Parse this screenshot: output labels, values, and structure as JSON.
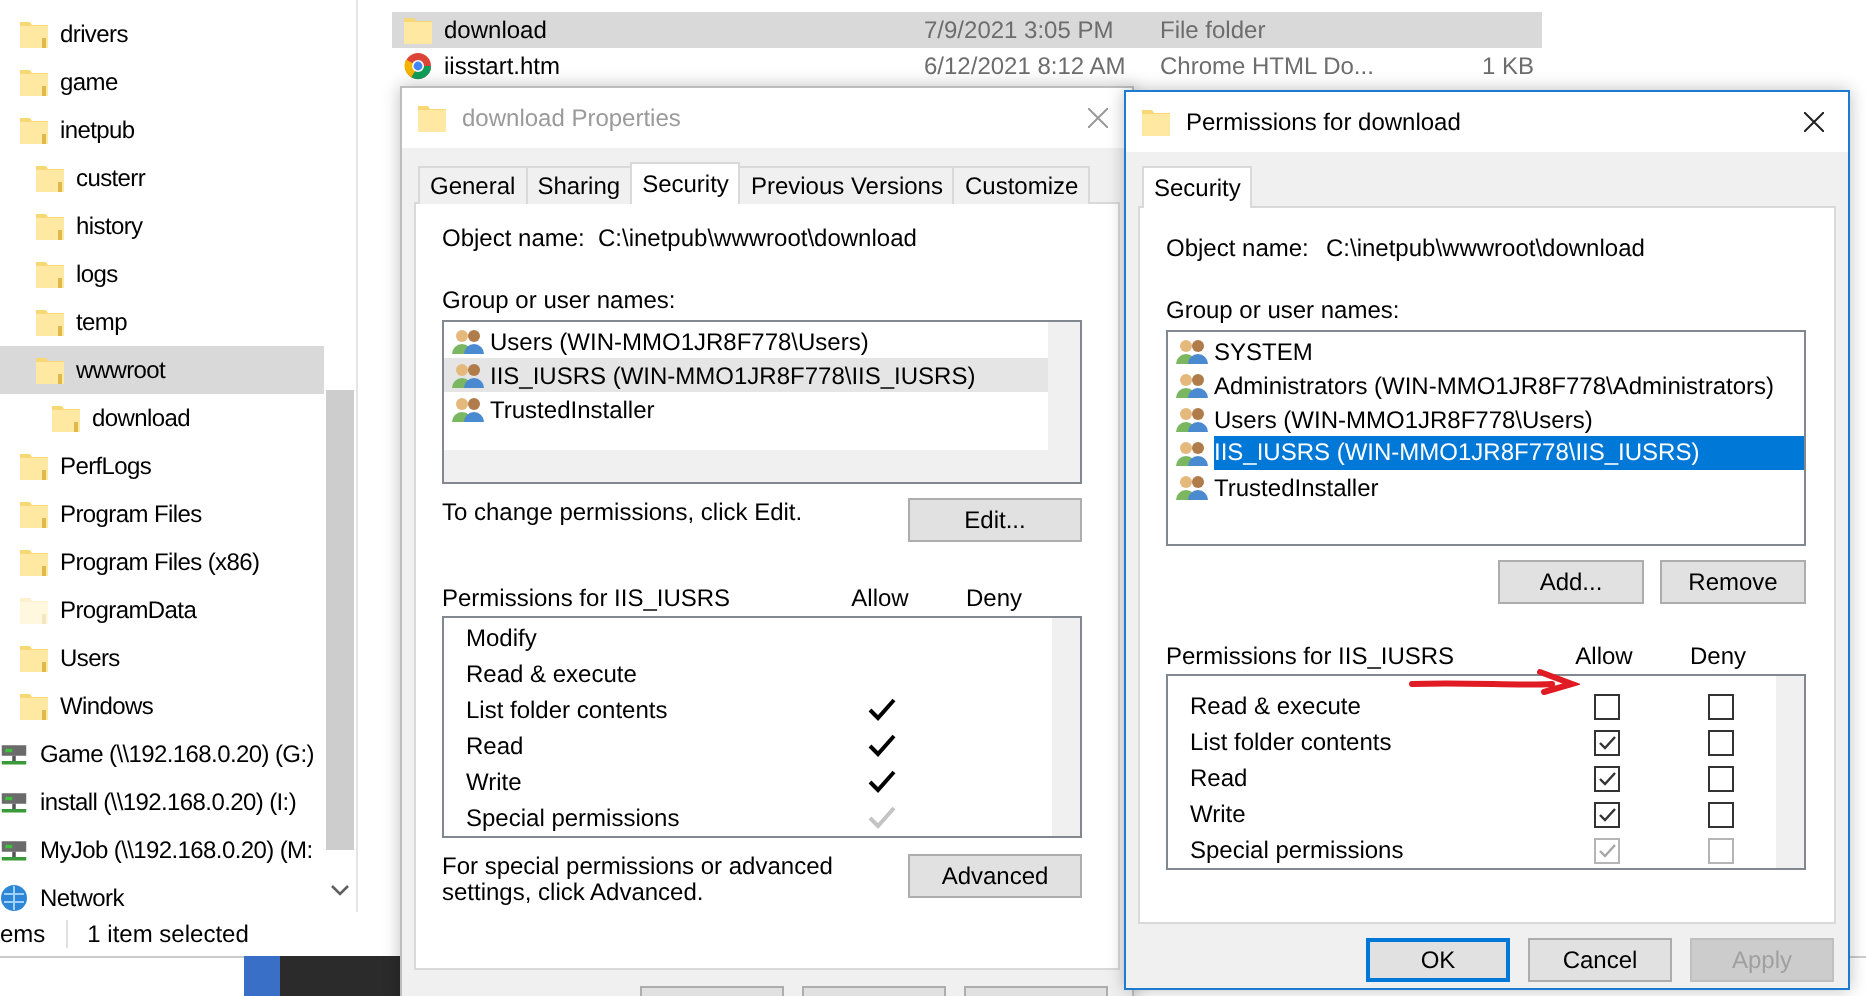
{
  "explorer": {
    "nav_tree": [
      {
        "name": "drivers",
        "kind": "folder",
        "selected": false
      },
      {
        "name": "game",
        "kind": "folder",
        "selected": false
      },
      {
        "name": "inetpub",
        "kind": "folder",
        "selected": false,
        "children": [
          {
            "name": "custerr",
            "kind": "folder",
            "selected": false
          },
          {
            "name": "history",
            "kind": "folder",
            "selected": false
          },
          {
            "name": "logs",
            "kind": "folder",
            "selected": false
          },
          {
            "name": "temp",
            "kind": "folder",
            "selected": false
          },
          {
            "name": "wwwroot",
            "kind": "folder",
            "selected": true,
            "children": [
              {
                "name": "download",
                "kind": "folder",
                "selected": false
              }
            ]
          }
        ]
      },
      {
        "name": "PerfLogs",
        "kind": "folder",
        "selected": false
      },
      {
        "name": "Program Files",
        "kind": "folder",
        "selected": false
      },
      {
        "name": "Program Files (x86)",
        "kind": "folder",
        "selected": false
      },
      {
        "name": "ProgramData",
        "kind": "hidden-folder",
        "selected": false
      },
      {
        "name": "Users",
        "kind": "folder",
        "selected": false
      },
      {
        "name": "Windows",
        "kind": "folder",
        "selected": false
      },
      {
        "name": "Game (\\\\192.168.0.20) (G:)",
        "kind": "drive",
        "selected": false
      },
      {
        "name": "install (\\\\192.168.0.20) (I:)",
        "kind": "drive",
        "selected": false
      },
      {
        "name": "MyJob (\\\\192.168.0.20) (M:",
        "kind": "drive",
        "selected": false
      },
      {
        "name": "Network",
        "kind": "network",
        "selected": false
      }
    ],
    "files": [
      {
        "name": "download",
        "kind": "folder",
        "date": "7/9/2021 3:05 PM",
        "type": "File folder",
        "selected": true
      },
      {
        "name": "iisstart.htm",
        "kind": "web",
        "date": "6/12/2021 8:12 AM",
        "type": "Chrome HTML Do...",
        "size": "1 KB",
        "selected": false
      }
    ],
    "status_bar": {
      "count": "ems",
      "selection": "1 item selected"
    }
  },
  "properties_dialog": {
    "title": "download Properties",
    "tabs": [
      {
        "label": "General",
        "selected": false
      },
      {
        "label": "Sharing",
        "selected": false
      },
      {
        "label": "Security",
        "selected": true
      },
      {
        "label": "Previous Versions",
        "selected": false
      },
      {
        "label": "Customize",
        "selected": false
      }
    ],
    "object_label": "Object name:",
    "object_name": "C:\\inetpub\\wwwroot\\download",
    "group_label": "Group or user names:",
    "users": [
      {
        "name": "Users (WIN-MMO1JR8F778\\Users)",
        "selected": false
      },
      {
        "name": "IIS_IUSRS (WIN-MMO1JR8F778\\IIS_IUSRS)",
        "selected": true
      },
      {
        "name": "TrustedInstaller",
        "selected": false
      }
    ],
    "change_hint": "To change permissions, click Edit.",
    "edit_button": "Edit...",
    "permissions_label": "Permissions for IIS_IUSRS",
    "allow_header": "Allow",
    "deny_header": "Deny",
    "permissions": [
      {
        "name": "Modify",
        "allow": false,
        "deny": false
      },
      {
        "name": "Read & execute",
        "allow": false,
        "deny": false
      },
      {
        "name": "List folder contents",
        "allow": true,
        "deny": false
      },
      {
        "name": "Read",
        "allow": true,
        "deny": false
      },
      {
        "name": "Write",
        "allow": true,
        "deny": false
      },
      {
        "name": "Special permissions",
        "allow": true,
        "deny": false,
        "inherited": true
      }
    ],
    "advanced_hint": "For special permissions or advanced settings, click Advanced.",
    "advanced_button": "Advanced"
  },
  "permissions_dialog": {
    "title": "Permissions for download",
    "tabs": [
      {
        "label": "Security",
        "selected": true
      }
    ],
    "object_label": "Object name:",
    "object_name": "C:\\inetpub\\wwwroot\\download",
    "group_label": "Group or user names:",
    "users": [
      {
        "name": "SYSTEM",
        "selected": false
      },
      {
        "name": "Administrators (WIN-MMO1JR8F778\\Administrators)",
        "selected": false
      },
      {
        "name": "Users (WIN-MMO1JR8F778\\Users)",
        "selected": false
      },
      {
        "name": "IIS_IUSRS (WIN-MMO1JR8F778\\IIS_IUSRS)",
        "selected": true
      },
      {
        "name": "TrustedInstaller",
        "selected": false
      }
    ],
    "add_button": "Add...",
    "remove_button": "Remove",
    "permissions_label": "Permissions for IIS_IUSRS",
    "allow_header": "Allow",
    "deny_header": "Deny",
    "permissions": [
      {
        "name": "Read & execute",
        "allow": false,
        "deny": false,
        "disabled": false
      },
      {
        "name": "List folder contents",
        "allow": true,
        "deny": false,
        "disabled": false
      },
      {
        "name": "Read",
        "allow": true,
        "deny": false,
        "disabled": false
      },
      {
        "name": "Write",
        "allow": true,
        "deny": false,
        "disabled": false
      },
      {
        "name": "Special permissions",
        "allow": true,
        "deny": false,
        "disabled": true
      }
    ],
    "buttons": [
      {
        "label": "OK",
        "default": true,
        "disabled": false
      },
      {
        "label": "Cancel",
        "default": false,
        "disabled": false
      },
      {
        "label": "Apply",
        "default": false,
        "disabled": true
      }
    ]
  }
}
